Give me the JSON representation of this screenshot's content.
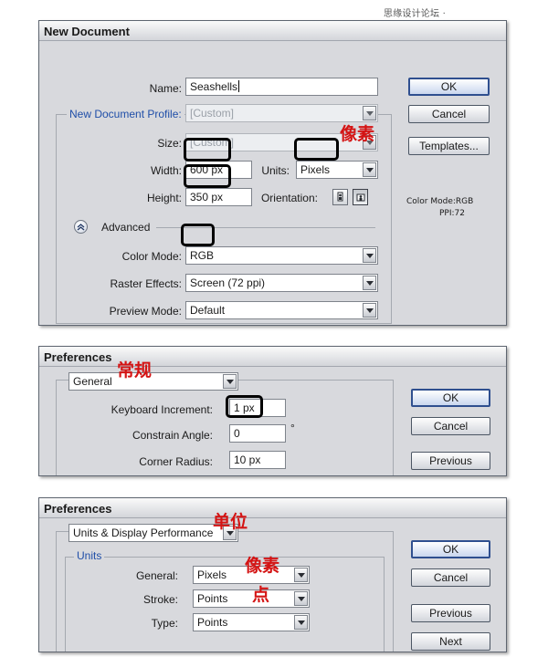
{
  "watermark": "思缘设计论坛 · WWW.MISSYUAN.COM",
  "new_document": {
    "title": "New Document",
    "name_label": "Name:",
    "name_value": "Seashells",
    "profile_label": "New Document Profile:",
    "profile_value": "[Custom]",
    "size_label": "Size:",
    "size_value": "[Custom]",
    "width_label": "Width:",
    "width_value": "600 px",
    "height_label": "Height:",
    "height_value": "350 px",
    "units_label": "Units:",
    "units_value": "Pixels",
    "orientation_label": "Orientation:",
    "advanced_label": "Advanced",
    "color_mode_label": "Color Mode:",
    "color_mode_value": "RGB",
    "raster_label": "Raster Effects:",
    "raster_value": "Screen (72 ppi)",
    "preview_label": "Preview Mode:",
    "preview_value": "Default",
    "ok": "OK",
    "cancel": "Cancel",
    "templates": "Templates...",
    "info_color_mode": "Color Mode:RGB",
    "info_ppi": "PPI:72",
    "annotation": "像素"
  },
  "prefs_general": {
    "title": "Preferences",
    "section_value": "General",
    "keyboard_label": "Keyboard Increment:",
    "keyboard_value": "1 px",
    "constrain_label": "Constrain Angle:",
    "constrain_value": "0",
    "degree": "°",
    "corner_label": "Corner Radius:",
    "corner_value": "10 px",
    "ok": "OK",
    "cancel": "Cancel",
    "previous": "Previous",
    "annotation": "常规"
  },
  "prefs_units": {
    "title": "Preferences",
    "section_value": "Units & Display Performance",
    "units_group": "Units",
    "general_label": "General:",
    "general_value": "Pixels",
    "stroke_label": "Stroke:",
    "stroke_value": "Points",
    "type_label": "Type:",
    "type_value": "Points",
    "ok": "OK",
    "cancel": "Cancel",
    "previous": "Previous",
    "next": "Next",
    "annotation_units": "单位",
    "annotation_pixels": "像素",
    "annotation_points": "点"
  },
  "colors": {
    "annotation_red": "#d41414",
    "group_label_blue": "#1f4ea8",
    "default_button_border": "#2f4f8f"
  }
}
